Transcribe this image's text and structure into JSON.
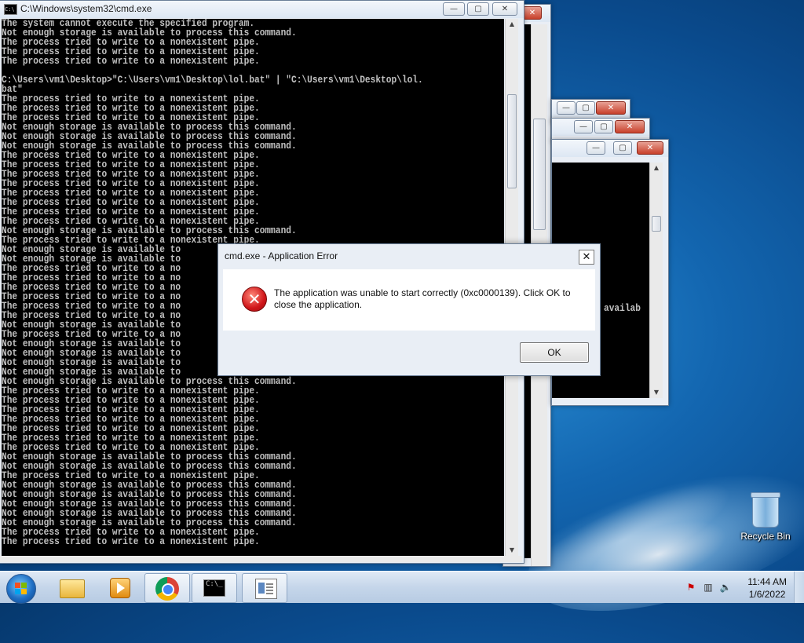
{
  "desktop": {
    "recycle_bin_label": "Recycle Bin"
  },
  "main_window": {
    "title": "C:\\Windows\\system32\\cmd.exe",
    "lines": [
      "The system cannot execute the specified program.",
      "Not enough storage is available to process this command.",
      "The process tried to write to a nonexistent pipe.",
      "The process tried to write to a nonexistent pipe.",
      "The process tried to write to a nonexistent pipe.",
      "",
      "C:\\Users\\vm1\\Desktop>\"C:\\Users\\vm1\\Desktop\\lol.bat\" | \"C:\\Users\\vm1\\Desktop\\lol.",
      "bat\"",
      "The process tried to write to a nonexistent pipe.",
      "The process tried to write to a nonexistent pipe.",
      "The process tried to write to a nonexistent pipe.",
      "Not enough storage is available to process this command.",
      "Not enough storage is available to process this command.",
      "Not enough storage is available to process this command.",
      "The process tried to write to a nonexistent pipe.",
      "The process tried to write to a nonexistent pipe.",
      "The process tried to write to a nonexistent pipe.",
      "The process tried to write to a nonexistent pipe.",
      "The process tried to write to a nonexistent pipe.",
      "The process tried to write to a nonexistent pipe.",
      "The process tried to write to a nonexistent pipe.",
      "The process tried to write to a nonexistent pipe.",
      "Not enough storage is available to process this command.",
      "The process tried to write to a nonexistent pipe.",
      "Not enough storage is available to",
      "Not enough storage is available to",
      "The process tried to write to a no",
      "The process tried to write to a no",
      "The process tried to write to a no",
      "The process tried to write to a no",
      "The process tried to write to a no",
      "The process tried to write to a no",
      "Not enough storage is available to",
      "The process tried to write to a no",
      "Not enough storage is available to",
      "Not enough storage is available to",
      "Not enough storage is available to",
      "Not enough storage is available to",
      "Not enough storage is available to process this command.",
      "The process tried to write to a nonexistent pipe.",
      "The process tried to write to a nonexistent pipe.",
      "The process tried to write to a nonexistent pipe.",
      "The process tried to write to a nonexistent pipe.",
      "The process tried to write to a nonexistent pipe.",
      "The process tried to write to a nonexistent pipe.",
      "The process tried to write to a nonexistent pipe.",
      "Not enough storage is available to process this command.",
      "Not enough storage is available to process this command.",
      "The process tried to write to a nonexistent pipe.",
      "Not enough storage is available to process this command.",
      "Not enough storage is available to process this command.",
      "Not enough storage is available to process this command.",
      "Not enough storage is available to process this command.",
      "Not enough storage is available to process this command.",
      "The process tried to write to a nonexistent pipe.",
      "The process tried to write to a nonexistent pipe."
    ]
  },
  "side_window": {
    "partial_text": "availab"
  },
  "dialog": {
    "title": "cmd.exe - Application Error",
    "message": "The application was unable to start correctly (0xc0000139). Click OK to close the application.",
    "ok_label": "OK",
    "close_glyph": "✕"
  },
  "caption": {
    "minimize": "—",
    "maximize": "▢",
    "close": "✕"
  },
  "taskbar": {
    "cmd_icon_text": "C:\\_",
    "clock_time": "11:44 AM",
    "clock_date": "1/6/2022"
  },
  "colors": {
    "console_bg": "#000000",
    "console_text": "#c0c0c0",
    "close_red": "#c8402a"
  }
}
